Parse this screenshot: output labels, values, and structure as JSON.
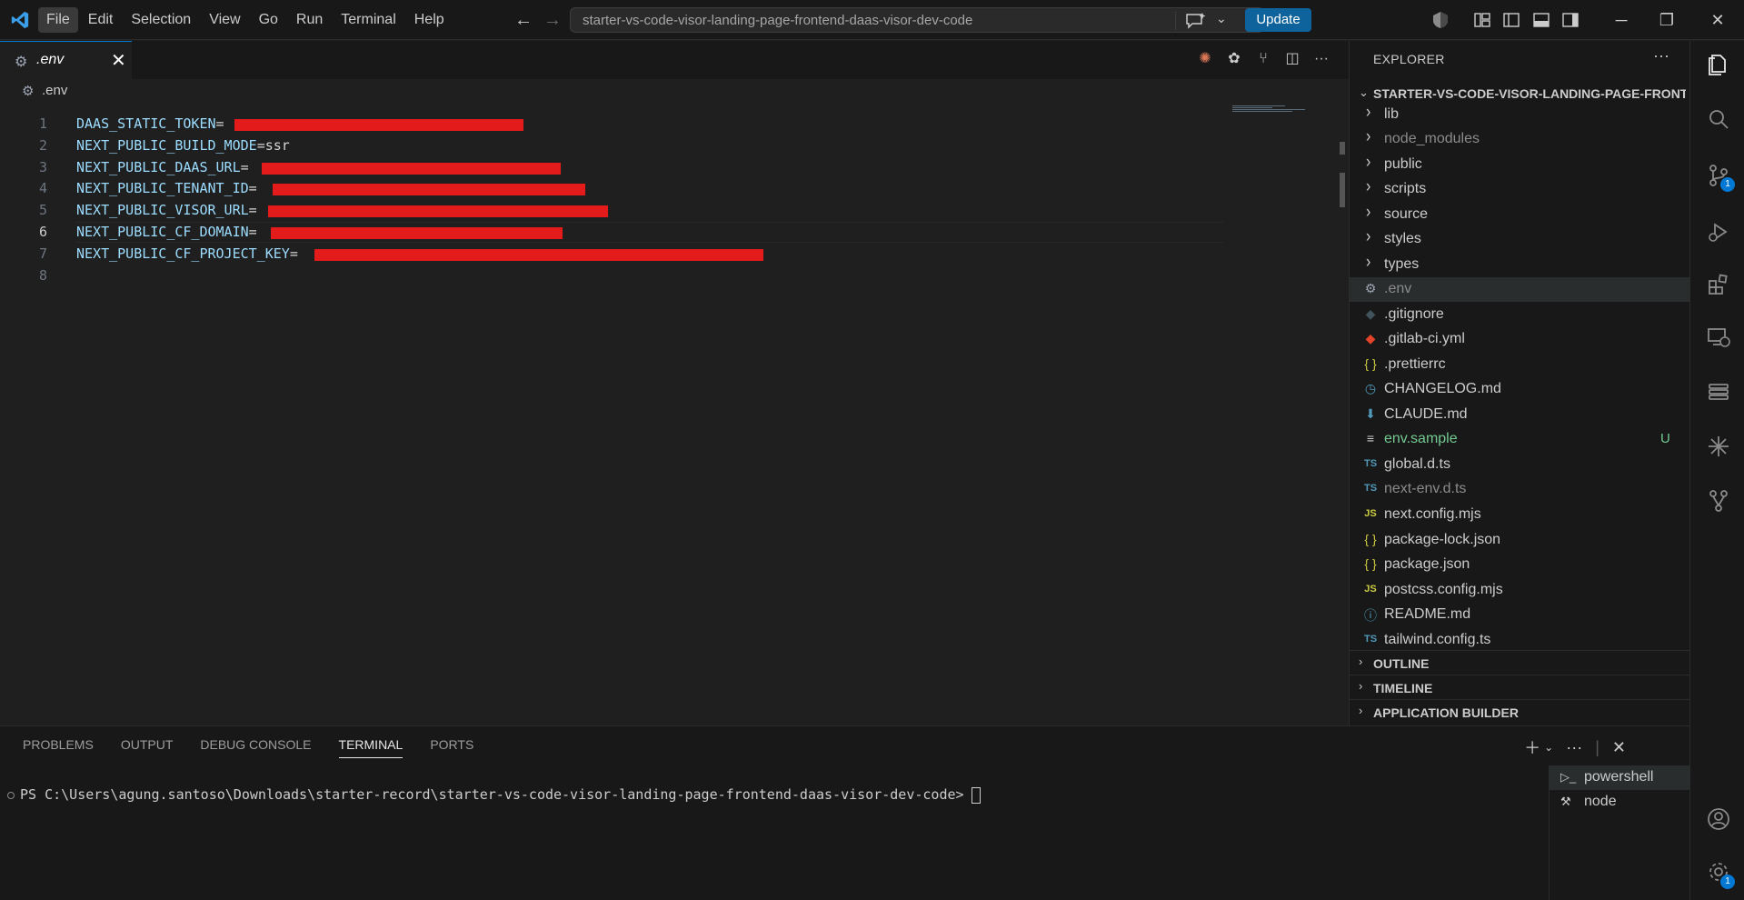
{
  "menu": {
    "items": [
      "File",
      "Edit",
      "Selection",
      "View",
      "Go",
      "Run",
      "Terminal",
      "Help"
    ]
  },
  "command_center": {
    "text": "starter-vs-code-visor-landing-page-frontend-daas-visor-dev-code"
  },
  "update_label": "Update",
  "tab": {
    "label": ".env",
    "close": "✕"
  },
  "breadcrumb": {
    "label": ".env"
  },
  "editor": {
    "lines": [
      {
        "num": "1",
        "key": "DAAS_STATIC_TOKEN",
        "eq": "=",
        "value": ""
      },
      {
        "num": "2",
        "key": "NEXT_PUBLIC_BUILD_MODE",
        "eq": "=",
        "value": "ssr"
      },
      {
        "num": "3",
        "key": "NEXT_PUBLIC_DAAS_URL",
        "eq": "=",
        "value": ""
      },
      {
        "num": "4",
        "key": "NEXT_PUBLIC_TENANT_ID",
        "eq": "=",
        "value": ""
      },
      {
        "num": "5",
        "key": "NEXT_PUBLIC_VISOR_URL",
        "eq": "=",
        "value": ""
      },
      {
        "num": "6",
        "key": "NEXT_PUBLIC_CF_DOMAIN",
        "eq": "=",
        "value": ""
      },
      {
        "num": "7",
        "key": "NEXT_PUBLIC_CF_PROJECT_KEY",
        "eq": "=",
        "value": ""
      },
      {
        "num": "8",
        "key": "",
        "eq": "",
        "value": ""
      }
    ],
    "current_line": "6"
  },
  "explorer": {
    "title": "EXPLORER",
    "more": "···",
    "project": "STARTER-VS-CODE-VISOR-LANDING-PAGE-FRONTE...",
    "folders": [
      "lib",
      "node_modules",
      "public",
      "scripts",
      "source",
      "styles",
      "types"
    ],
    "files": [
      {
        "name": ".env",
        "icon": "⚙",
        "color": "#9da5b4",
        "style": "dim"
      },
      {
        "name": ".gitignore",
        "icon": "◆",
        "color": "#41535b",
        "style": ""
      },
      {
        "name": ".gitlab-ci.yml",
        "icon": "◆",
        "color": "#e2432a",
        "style": ""
      },
      {
        "name": ".prettierrc",
        "icon": "{ }",
        "color": "#cbcb41",
        "style": ""
      },
      {
        "name": "CHANGELOG.md",
        "icon": "◷",
        "color": "#519aba",
        "style": ""
      },
      {
        "name": "CLAUDE.md",
        "icon": "⬇",
        "color": "#519aba",
        "style": ""
      },
      {
        "name": "env.sample",
        "icon": "≡",
        "color": "#cccccc",
        "style": "green",
        "badge": "U"
      },
      {
        "name": "global.d.ts",
        "icon": "TS",
        "color": "#519aba",
        "style": ""
      },
      {
        "name": "next-env.d.ts",
        "icon": "TS",
        "color": "#519aba",
        "style": "dim"
      },
      {
        "name": "next.config.mjs",
        "icon": "JS",
        "color": "#cbcb41",
        "style": ""
      },
      {
        "name": "package-lock.json",
        "icon": "{ }",
        "color": "#cbcb41",
        "style": ""
      },
      {
        "name": "package.json",
        "icon": "{ }",
        "color": "#cbcb41",
        "style": ""
      },
      {
        "name": "postcss.config.mjs",
        "icon": "JS",
        "color": "#cbcb41",
        "style": ""
      },
      {
        "name": "README.md",
        "icon": "ⓘ",
        "color": "#519aba",
        "style": ""
      },
      {
        "name": "tailwind.config.ts",
        "icon": "TS",
        "color": "#519aba",
        "style": ""
      }
    ],
    "sections": [
      "OUTLINE",
      "TIMELINE",
      "APPLICATION BUILDER"
    ]
  },
  "activity_badges": {
    "source_control": "1",
    "settings": "1"
  },
  "panel": {
    "tabs": [
      "PROBLEMS",
      "OUTPUT",
      "DEBUG CONSOLE",
      "TERMINAL",
      "PORTS"
    ],
    "active_tab": "TERMINAL",
    "prompt": "PS C:\\Users\\agung.santoso\\Downloads\\starter-record\\starter-vs-code-visor-landing-page-frontend-daas-visor-dev-code>",
    "terminals": [
      "powershell",
      "node"
    ]
  },
  "colors": {
    "accent": "#0078d4",
    "redaction": "#e41b1b",
    "update_button": "#0e639c"
  }
}
